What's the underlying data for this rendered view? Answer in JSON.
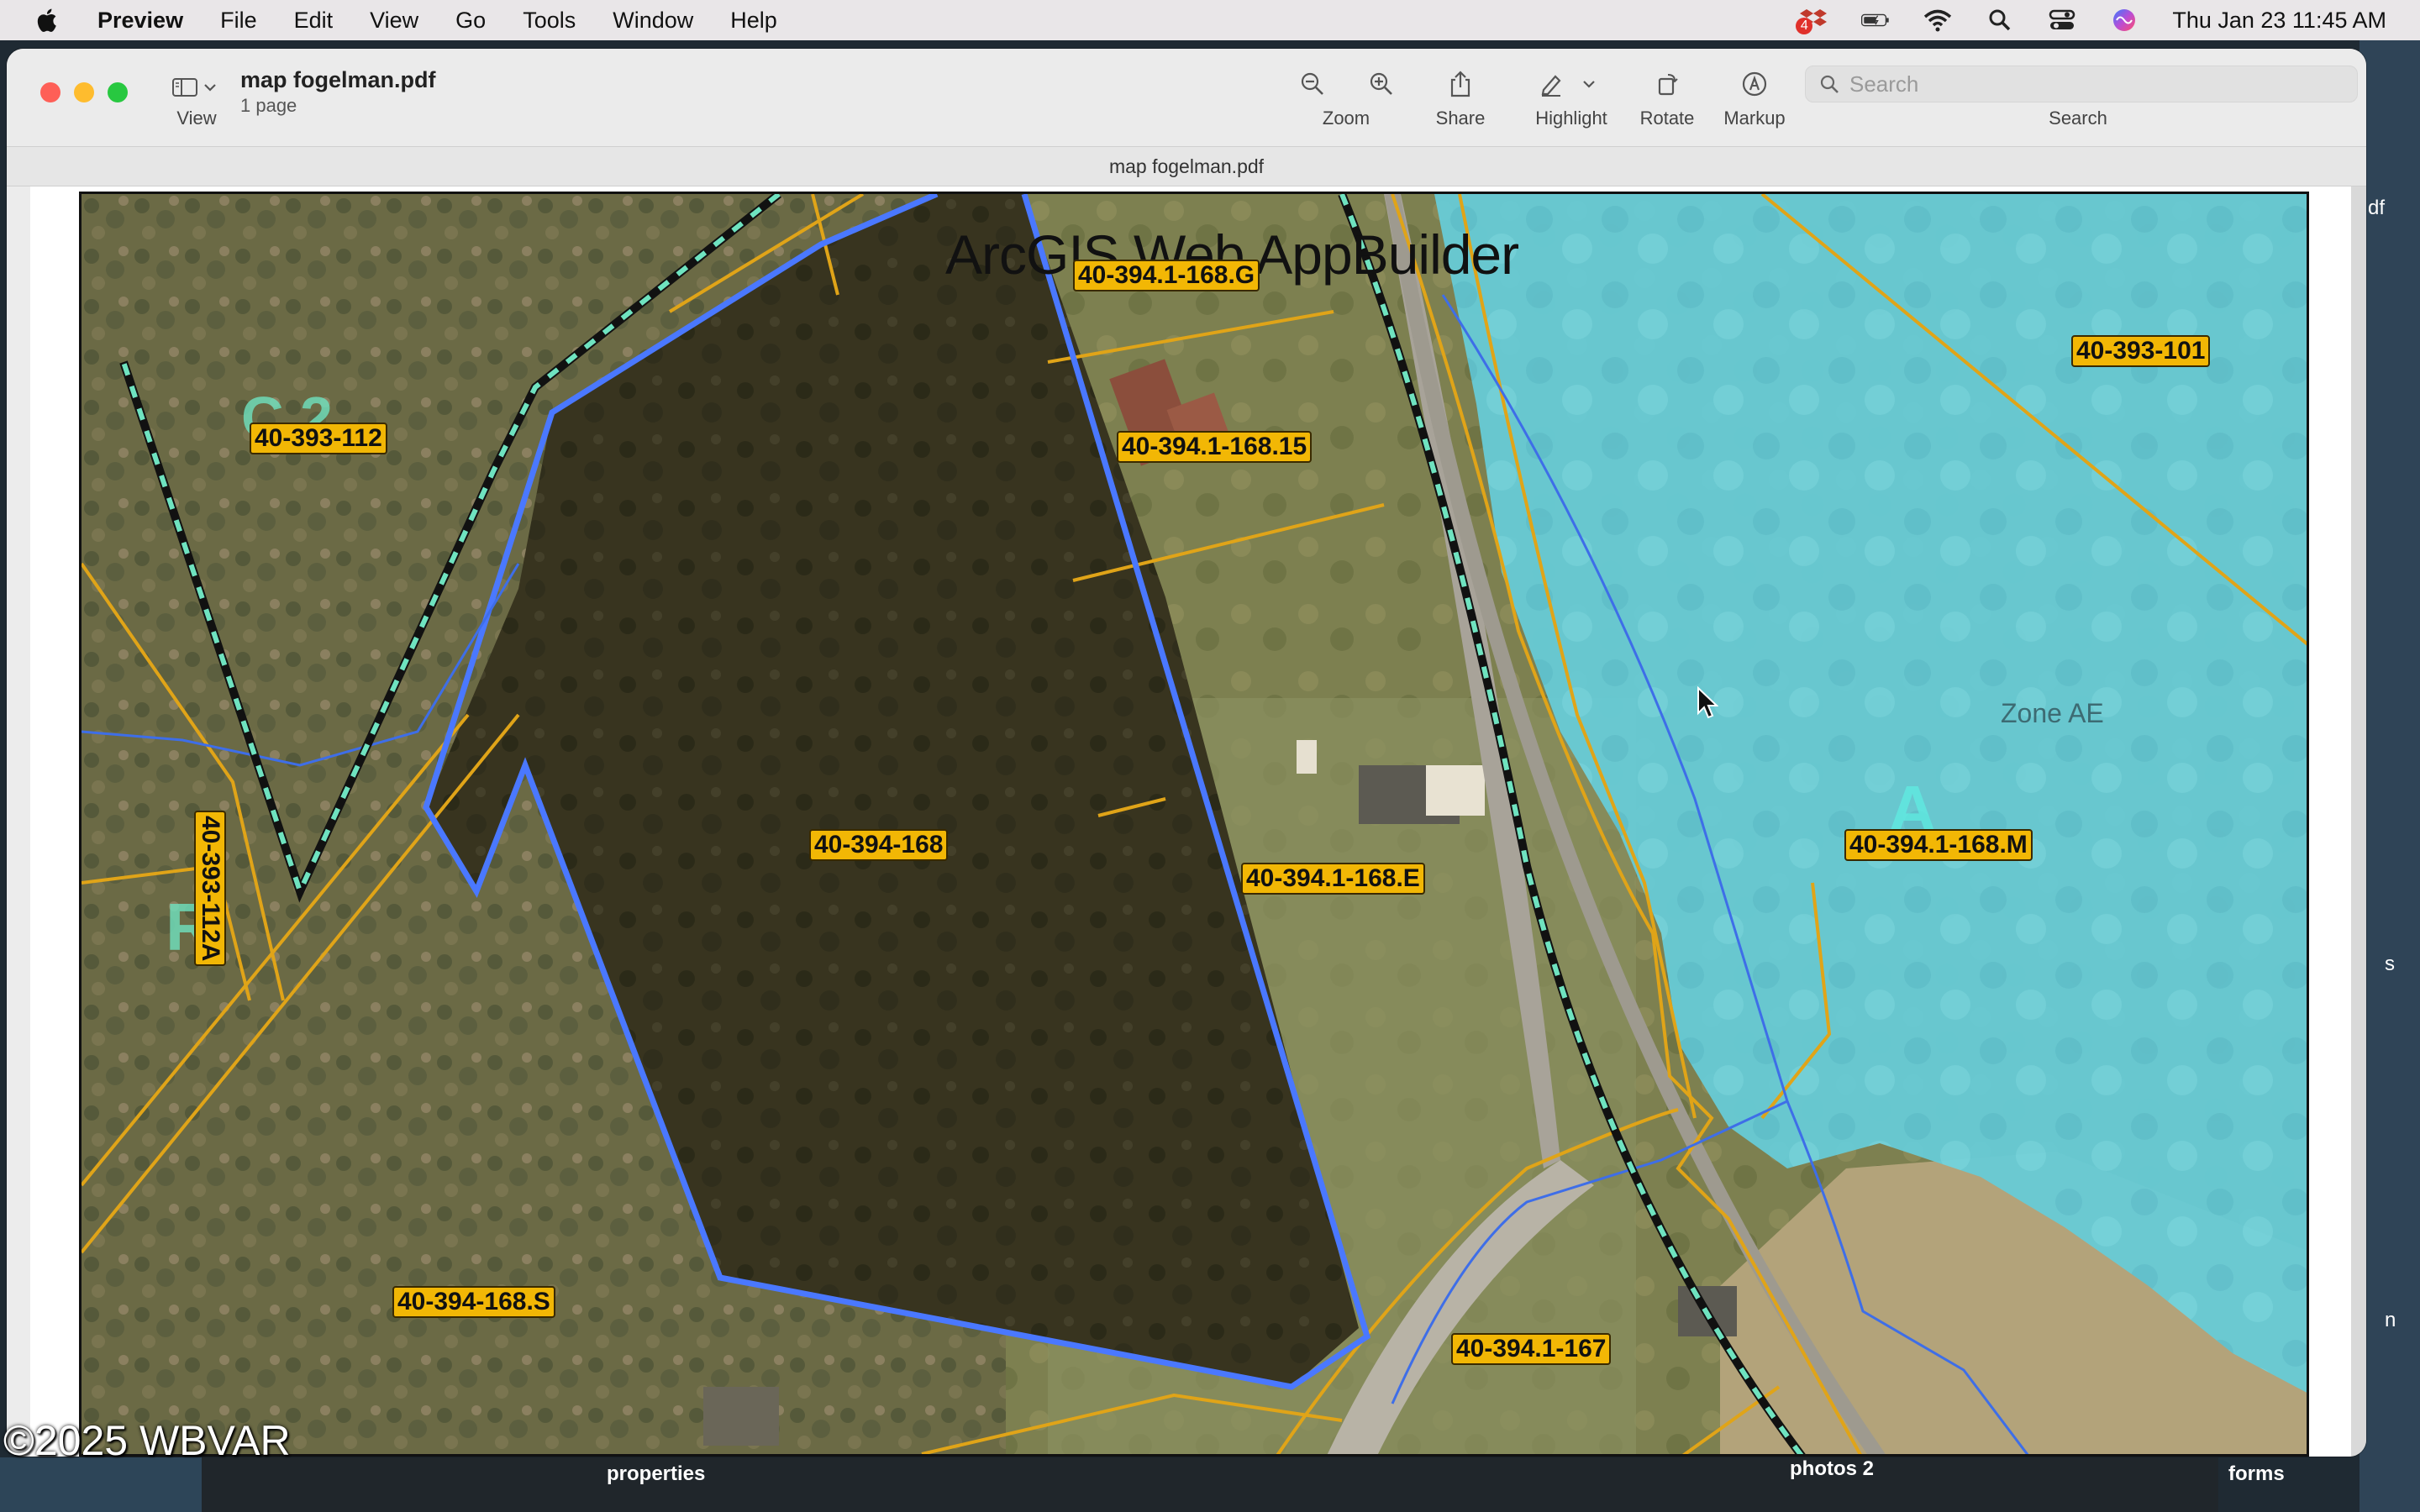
{
  "menubar": {
    "app_name": "Preview",
    "items": [
      "File",
      "Edit",
      "View",
      "Go",
      "Tools",
      "Window",
      "Help"
    ],
    "notification_count": "4",
    "clock": "Thu Jan 23  11:45 AM"
  },
  "window": {
    "doc_title": "map fogelman.pdf",
    "doc_pages": "1 page",
    "tab_title": "map fogelman.pdf",
    "toolbar": {
      "view_label": "View",
      "zoom_label": "Zoom",
      "share_label": "Share",
      "highlight_label": "Highlight",
      "rotate_label": "Rotate",
      "markup_label": "Markup",
      "search_label": "Search",
      "search_placeholder": "Search"
    }
  },
  "map": {
    "title": "ArcGIS Web AppBuilder",
    "zone_label": "Zone AE",
    "parcels": {
      "p1": "40-394.1-168.G",
      "p2": "40-393-101",
      "p3": "40-393-112",
      "p4": "40-394.1-168.15",
      "p5": "40-394-168",
      "p6": "40-394.1-168.E",
      "p7": "40-394.1-168.M",
      "p8": "40-393-112A",
      "p9": "40-394-168.S",
      "p10": "40-394.1-167"
    }
  },
  "background": {
    "bottom_labels": [
      "properties",
      "photos 2",
      "forms"
    ],
    "right_labels": [
      "df",
      "s",
      "n"
    ]
  },
  "watermark": "©2025 WBVAR",
  "colors": {
    "flood_zone": "#5fd0dc",
    "parcel_line": "#e0a418",
    "boundary_line": "#4a78ff",
    "label_bg": "#f2b705"
  }
}
